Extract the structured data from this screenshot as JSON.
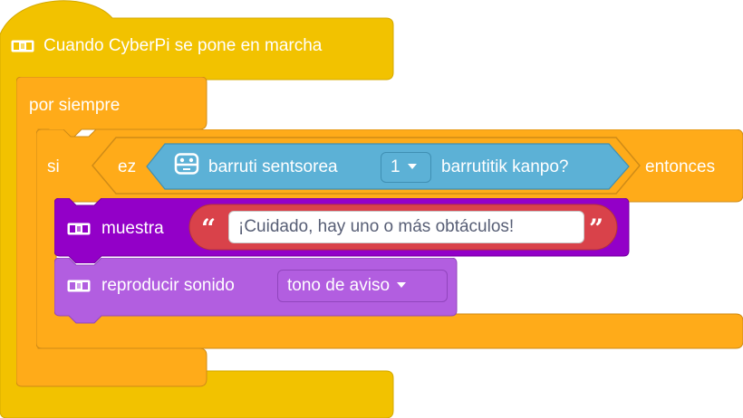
{
  "hat_block": {
    "label": "Cuando CyberPi se pone en marcha"
  },
  "forever_block": {
    "label": "por siempre"
  },
  "if_block": {
    "label_if": "si",
    "label_then": "entonces"
  },
  "not_block": {
    "label": "ez"
  },
  "sensor_block": {
    "label_before": "barruti sentsorea",
    "port_value": "1",
    "label_after": "barrutitik kanpo?"
  },
  "show_block": {
    "label": "muestra",
    "open_quote": "“",
    "text_value": "¡Cuidado, hay uno o más obtáculos!",
    "close_quote": "”"
  },
  "sound_block": {
    "label": "reproducir sonido",
    "sound_value": "tono de aviso"
  },
  "colors": {
    "events": "#f2c200",
    "control": "#ffab19",
    "operator": "#ffab19",
    "sensor": "#5cb1d6",
    "display": "#9300c8",
    "audio": "#b25ee0",
    "text_reporter": "#d9424a"
  },
  "icons": [
    "cyberpi-icon",
    "ultrasonic-sensor-icon",
    "dropdown-arrow-icon",
    "quote-icon"
  ]
}
